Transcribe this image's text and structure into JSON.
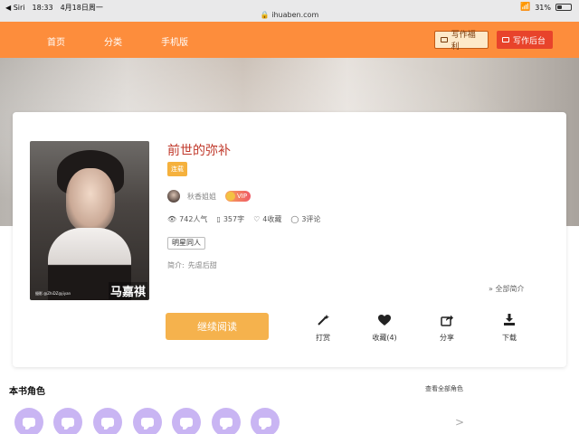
{
  "status_bar": {
    "back_label": "◀ Siri",
    "time": "18:33",
    "date": "4月18日周一",
    "url": "ihuaben.com",
    "battery": "31%"
  },
  "nav": {
    "home": "首页",
    "categories": "分类",
    "mobile": "手机版",
    "welfare_button": "写作福利",
    "backend_button": "写作后台"
  },
  "book": {
    "title": "前世的弥补",
    "status": "连载",
    "author": "秋香姐姐",
    "vip": "VIP",
    "popularity": "742人气",
    "words": "357字",
    "favorites": "4收藏",
    "comments": "3评论",
    "tag": "明星同人",
    "intro_label": "简介:",
    "intro_text": "先虐后甜",
    "intro_expand": "全部简介",
    "cover_name": "马嘉祺",
    "cover_credit": "摄影 @ZhiDZ@jiyan"
  },
  "actions": {
    "read": "继续阅读",
    "tip": "打赏",
    "favorite": "收藏(4)",
    "share": "分享",
    "download": "下载"
  },
  "roles": {
    "title": "本书角色",
    "view_all": "查看全部角色",
    "more": ">"
  },
  "colors": {
    "nav_orange": "#fd8d3c",
    "title_red": "#c0392b",
    "status_yellow": "#f5b13d",
    "read_button": "#f5b24d",
    "role_purple": "#c9b5f3"
  }
}
